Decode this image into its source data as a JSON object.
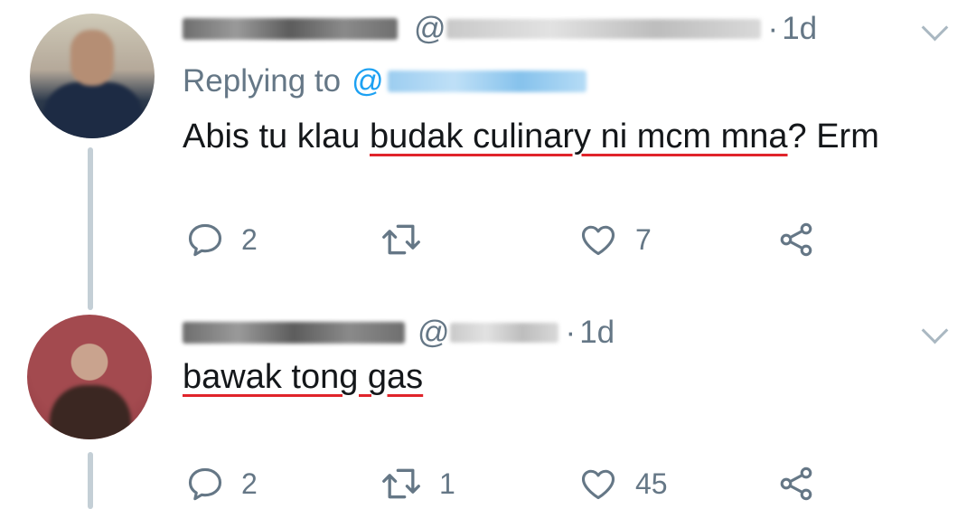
{
  "tweets": [
    {
      "handle_prefix": "@",
      "dot": "·",
      "time": "1d",
      "replying_label": "Replying to",
      "reply_at": "@",
      "text_plain": "Abis tu klau ",
      "text_underlined": "budak culinary ni mcm mna",
      "text_tail": "? Erm",
      "actions": {
        "reply": "2",
        "retweet": "",
        "like": "7"
      }
    },
    {
      "handle_prefix": "@",
      "dot": "·",
      "time": "1d",
      "text_underlined": "bawak tong gas",
      "actions": {
        "reply": "2",
        "retweet": "1",
        "like": "45"
      }
    }
  ],
  "icons": {
    "reply": "reply-icon",
    "retweet": "retweet-icon",
    "like": "heart-icon",
    "share": "share-icon",
    "menu": "chevron-down-icon"
  },
  "colors": {
    "accent": "#1da1f2",
    "muted": "#657786",
    "underline": "#e0242b",
    "thread": "#c4cfd6"
  }
}
